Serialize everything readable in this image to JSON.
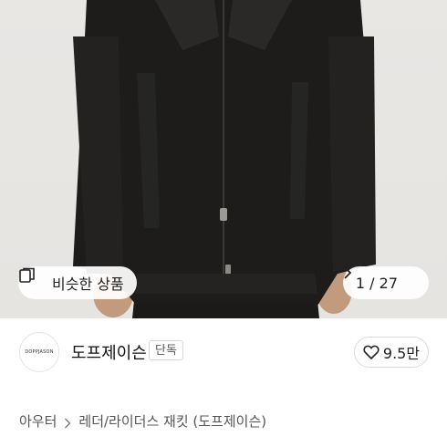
{
  "product_image": {
    "alt": "black leather jacket"
  },
  "similar_button": {
    "label": "비슷한 상품",
    "icon": "similar-items-icon"
  },
  "pager": {
    "text": "1 / 27",
    "icon": "chevron-right-icon"
  },
  "brand": {
    "logo_text": "DOPPJASON",
    "name": "도프제이슨",
    "badge": "단독"
  },
  "like": {
    "count": "9.5만",
    "icon": "heart-outline-icon"
  },
  "breadcrumb": {
    "items": [
      "아우터",
      "레더/라이더스 재킷 (도프제이슨)"
    ]
  },
  "colors": {
    "jacket": "#1a1917",
    "background": "#e8e6e3",
    "text": "#222222"
  }
}
